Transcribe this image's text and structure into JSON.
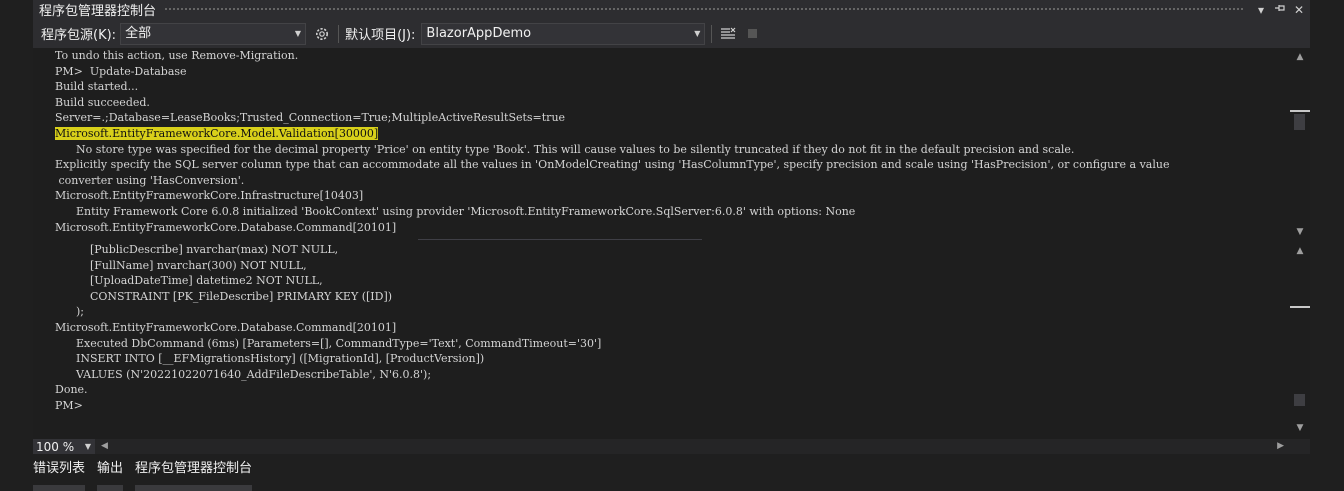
{
  "window": {
    "title": "程序包管理器控制台"
  },
  "toolbar": {
    "source_label": "程序包源(K):",
    "source_value": "全部",
    "project_label": "默认项目(J):",
    "project_value": "BlazorAppDemo",
    "settings_icon": "gear-icon",
    "clear_icon": "clear-console-icon",
    "stop_icon": "stop-icon"
  },
  "console_top": {
    "lines": [
      "To undo this action, use Remove-Migration.",
      "PM>  Update-Database",
      "Build started...",
      "Build succeeded.",
      "Server=.;Database=LeaseBooks;Trusted_Connection=True;MultipleActiveResultSets=true",
      "Microsoft.EntityFrameworkCore.Model.Validation[30000]",
      "      No store type was specified for the decimal property 'Price' on entity type 'Book'. This will cause values to be silently truncated if they do not fit in the default precision and scale.",
      "Explicitly specify the SQL server column type that can accommodate all the values in 'OnModelCreating' using 'HasColumnType', specify precision and scale using 'HasPrecision', or configure a value",
      " converter using 'HasConversion'.",
      "Microsoft.EntityFrameworkCore.Infrastructure[10403]",
      "      Entity Framework Core 6.0.8 initialized 'BookContext' using provider 'Microsoft.EntityFrameworkCore.SqlServer:6.0.8' with options: None",
      "Microsoft.EntityFrameworkCore.Database.Command[20101]"
    ]
  },
  "console_bottom": {
    "lines": [
      "          [PublicDescribe] nvarchar(max) NOT NULL,",
      "          [FullName] nvarchar(300) NOT NULL,",
      "          [UploadDateTime] datetime2 NOT NULL,",
      "          CONSTRAINT [PK_FileDescribe] PRIMARY KEY ([ID])",
      "      );",
      "Microsoft.EntityFrameworkCore.Database.Command[20101]",
      "      Executed DbCommand (6ms) [Parameters=[], CommandType='Text', CommandTimeout='30']",
      "      INSERT INTO [__EFMigrationsHistory] ([MigrationId], [ProductVersion])",
      "      VALUES (N'20221022071640_AddFileDescribeTable', N'6.0.8');",
      "Done.",
      "PM>"
    ]
  },
  "status": {
    "zoom": "100 %"
  },
  "tabs": [
    {
      "label": "错误列表"
    },
    {
      "label": "输出"
    },
    {
      "label": "程序包管理器控制台"
    }
  ],
  "colors": {
    "highlight": "#d8d01a",
    "background": "#1e1e1e",
    "chrome": "#2d2d30"
  }
}
